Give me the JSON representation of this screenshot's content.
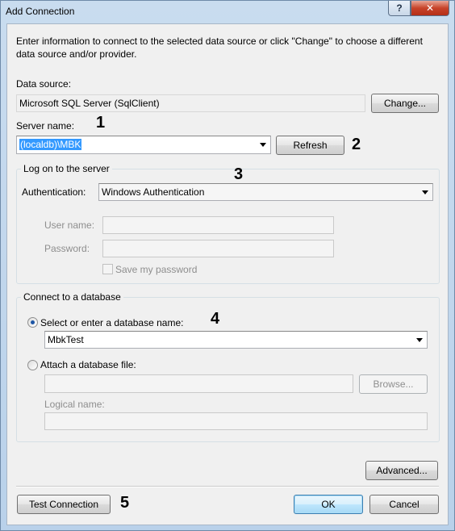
{
  "window": {
    "title": "Add Connection",
    "help_label": "?",
    "close_label": "✕"
  },
  "intro_text_line1": "Enter information to connect to the selected data source or click \"Change\" to choose a different",
  "intro_text_line2": "data source and/or provider.",
  "data_source": {
    "label": "Data source:",
    "value": "Microsoft SQL Server (SqlClient)",
    "change_label": "Change..."
  },
  "server": {
    "label": "Server name:",
    "value": "(localdb)\\MBK",
    "refresh_label": "Refresh"
  },
  "logon": {
    "group_title": "Log on to the server",
    "auth_label": "Authentication:",
    "auth_value": "Windows Authentication",
    "username_label": "User name:",
    "username_value": "",
    "password_label": "Password:",
    "password_value": "",
    "save_password_label": "Save my password",
    "save_password_checked": false
  },
  "database": {
    "group_title": "Connect to a database",
    "select_label": "Select or enter a database name:",
    "select_value": "MbkTest",
    "attach_label": "Attach a database file:",
    "attach_value": "",
    "browse_label": "Browse...",
    "logical_label": "Logical name:",
    "logical_value": ""
  },
  "buttons": {
    "advanced_label": "Advanced...",
    "test_label": "Test Connection",
    "ok_label": "OK",
    "cancel_label": "Cancel"
  },
  "annotations": [
    "1",
    "2",
    "3",
    "4",
    "5"
  ],
  "icons": {
    "dropdown": "chevron-down-icon",
    "help": "help-icon",
    "close": "close-icon"
  },
  "colors": {
    "title_bar": "#b9d1ea",
    "close_button": "#c7432a",
    "selection": "#3399ff",
    "dialog_background": "#f0f0f0"
  }
}
